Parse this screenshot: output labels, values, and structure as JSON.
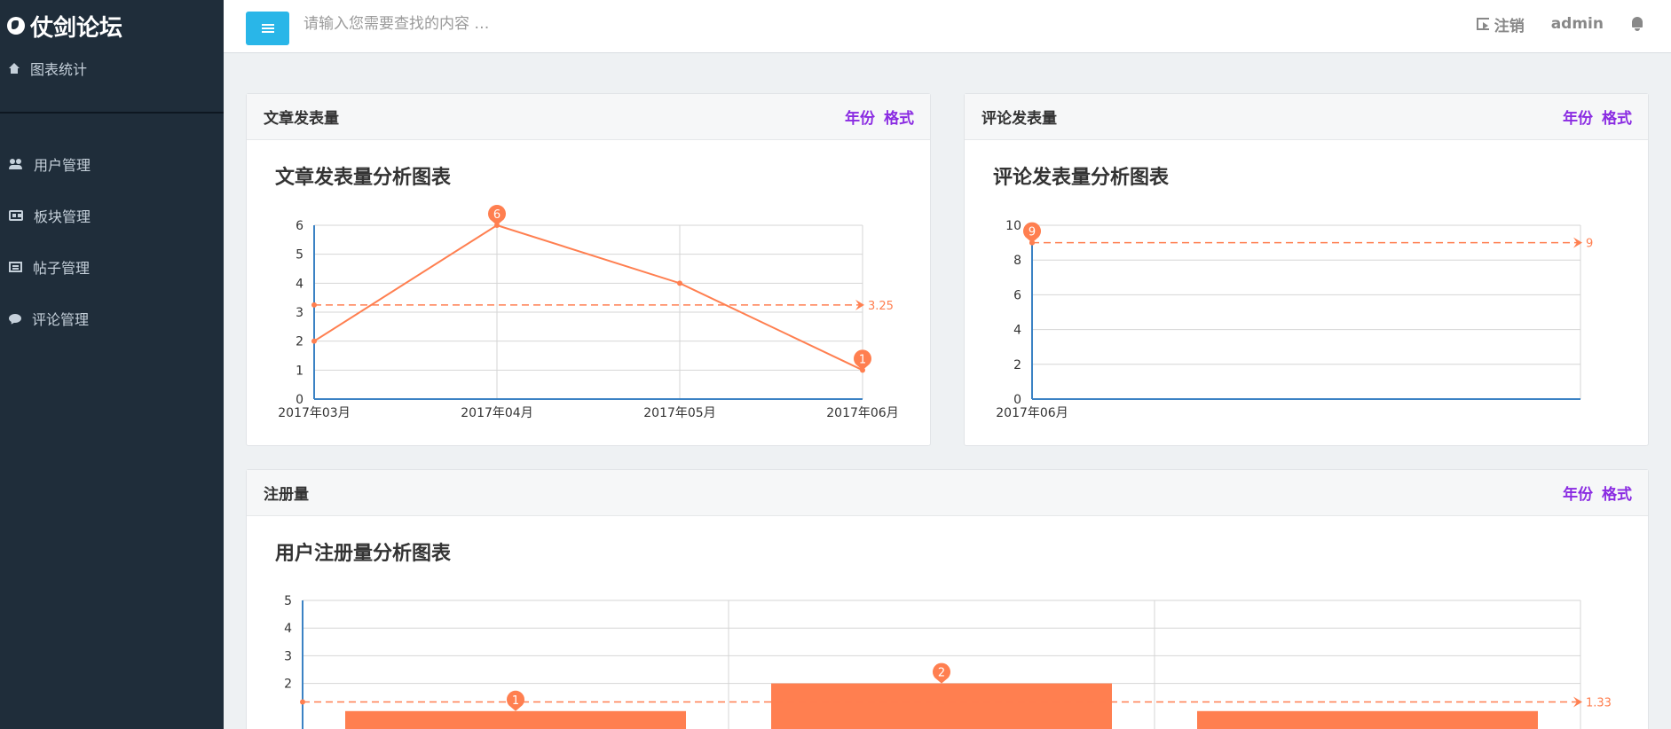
{
  "sidebar": {
    "brand": "仗剑论坛",
    "top_item": "图表统计",
    "items": [
      {
        "label": "用户管理"
      },
      {
        "label": "板块管理"
      },
      {
        "label": "帖子管理"
      },
      {
        "label": "评论管理"
      }
    ]
  },
  "header": {
    "search_placeholder": "请输入您需要查找的内容 …",
    "logout_label": "注销",
    "user": "admin"
  },
  "panels": {
    "articles": {
      "title": "文章发表量",
      "link_year": "年份",
      "link_format": "格式",
      "chart_title": "文章发表量分析图表"
    },
    "comments": {
      "title": "评论发表量",
      "link_year": "年份",
      "link_format": "格式",
      "chart_title": "评论发表量分析图表"
    },
    "registrations": {
      "title": "注册量",
      "link_year": "年份",
      "link_format": "格式",
      "chart_title": "用户注册量分析图表"
    }
  },
  "colors": {
    "accent": "#29b6e8",
    "series": "#ff7f50",
    "axis": "#3b82c4",
    "link": "#8a2be2",
    "sidebar": "#1f2d3a"
  },
  "chart_data": [
    {
      "type": "line",
      "title": "文章发表量分析图表",
      "categories": [
        "2017年03月",
        "2017年04月",
        "2017年05月",
        "2017年06月"
      ],
      "values": [
        2,
        6,
        4,
        1
      ],
      "ylim": [
        0,
        6
      ],
      "yticks": [
        "0",
        "1",
        "2",
        "3",
        "4",
        "5",
        "6"
      ],
      "mark_points": [
        {
          "label": "6",
          "index": 1
        },
        {
          "label": "1",
          "index": 3
        }
      ],
      "mark_line": {
        "value": 3.25,
        "label": "3.25"
      },
      "grid": true
    },
    {
      "type": "line",
      "title": "评论发表量分析图表",
      "categories": [
        "2017年06月"
      ],
      "values": [
        9
      ],
      "ylim": [
        0,
        10
      ],
      "yticks": [
        "0",
        "2",
        "4",
        "6",
        "8",
        "10"
      ],
      "mark_points": [
        {
          "label": "9",
          "index": 0
        }
      ],
      "mark_line": {
        "value": 9,
        "label": "9"
      },
      "grid": true
    },
    {
      "type": "bar",
      "title": "用户注册量分析图表",
      "categories": [
        "",
        "",
        ""
      ],
      "values": [
        1,
        2,
        1
      ],
      "ylim": [
        0,
        5
      ],
      "yticks": [
        "2",
        "3",
        "4",
        "5"
      ],
      "mark_points": [
        {
          "label": "1",
          "index": 0
        },
        {
          "label": "2",
          "index": 1
        }
      ],
      "mark_line": {
        "value": 1.33,
        "label": "1.33"
      },
      "grid": true
    }
  ]
}
